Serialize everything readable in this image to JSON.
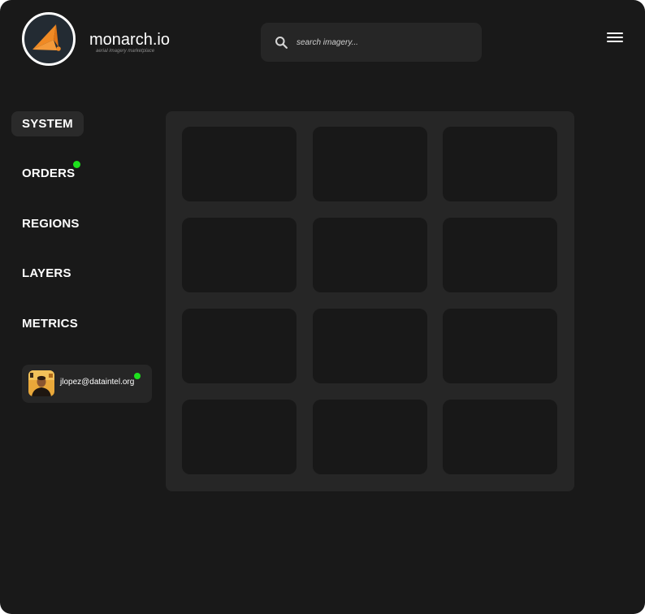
{
  "brand": {
    "name": "monarch.io",
    "tagline": "aerial imagery marketplace",
    "logo_icon": "monarch-kite-icon",
    "accent_color": "#f08a24"
  },
  "search": {
    "placeholder": "search imagery...",
    "value": "",
    "icon": "search-icon"
  },
  "header": {
    "menu_icon": "hamburger-menu-icon"
  },
  "nav": {
    "items": [
      {
        "label": "SYSTEM",
        "active": true,
        "indicator": false
      },
      {
        "label": "ORDERS",
        "active": false,
        "indicator": true
      },
      {
        "label": "REGIONS",
        "active": false,
        "indicator": false
      },
      {
        "label": "LAYERS",
        "active": false,
        "indicator": false
      },
      {
        "label": "METRICS",
        "active": false,
        "indicator": false
      }
    ],
    "indicator_color": "#1de11d"
  },
  "user": {
    "email": "jlopez@dataintel.org",
    "status": "online",
    "status_color": "#1de11d",
    "avatar_icon": "user-avatar"
  },
  "grid": {
    "rows": 4,
    "columns": 3,
    "tile_count": 12
  }
}
